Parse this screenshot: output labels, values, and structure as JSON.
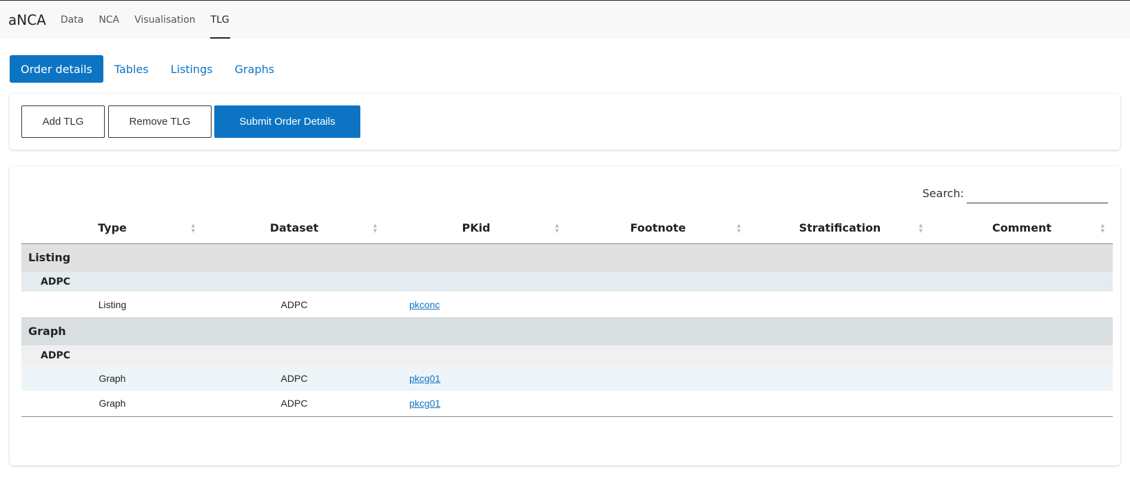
{
  "navbar": {
    "brand": "aNCA",
    "links": [
      {
        "label": "Data",
        "active": false
      },
      {
        "label": "NCA",
        "active": false
      },
      {
        "label": "Visualisation",
        "active": false
      },
      {
        "label": "TLG",
        "active": true
      }
    ]
  },
  "subtabs": [
    {
      "label": "Order details",
      "active": true
    },
    {
      "label": "Tables",
      "active": false
    },
    {
      "label": "Listings",
      "active": false
    },
    {
      "label": "Graphs",
      "active": false
    }
  ],
  "buttons": {
    "add": "Add TLG",
    "remove": "Remove TLG",
    "submit": "Submit Order Details"
  },
  "search": {
    "label": "Search:",
    "value": ""
  },
  "table": {
    "columns": [
      "Type",
      "Dataset",
      "PKid",
      "Footnote",
      "Stratification",
      "Comment"
    ],
    "groups": [
      {
        "label": "Listing",
        "subgroup": "ADPC",
        "rows": [
          {
            "type": "Listing",
            "dataset": "ADPC",
            "pkid": "pkconc",
            "footnote": "",
            "stratification": "",
            "comment": ""
          }
        ]
      },
      {
        "label": "Graph",
        "subgroup": "ADPC",
        "rows": [
          {
            "type": "Graph",
            "dataset": "ADPC",
            "pkid": "pkcg01",
            "footnote": "",
            "stratification": "",
            "comment": ""
          },
          {
            "type": "Graph",
            "dataset": "ADPC",
            "pkid": "pkcg01",
            "footnote": "",
            "stratification": "",
            "comment": ""
          }
        ]
      }
    ]
  },
  "colors": {
    "accent": "#0d74c4",
    "navbar_bg": "#f8f8f8",
    "group_header_bg": "#e0e0e0",
    "subgroup_bg": "#e4ecef"
  }
}
